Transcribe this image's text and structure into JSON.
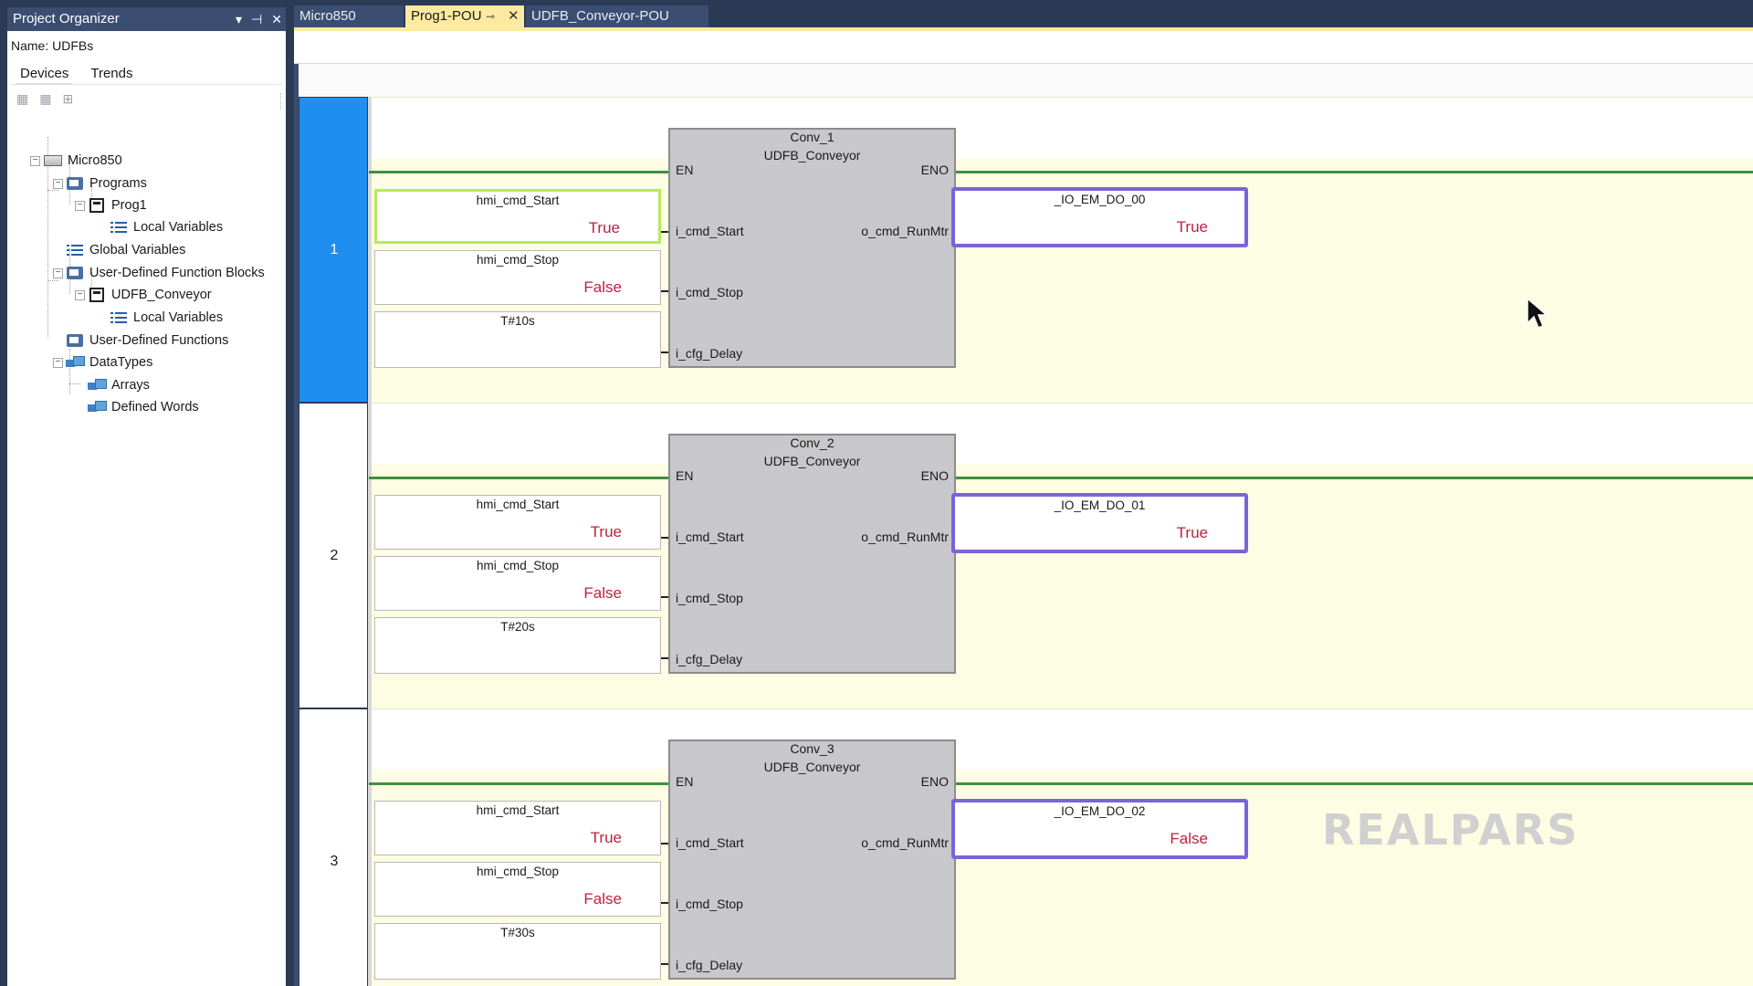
{
  "organizer": {
    "title": "Project Organizer",
    "controls": [
      "▾",
      "⊣",
      "✕"
    ],
    "name_label": "Name:",
    "name_value": "UDFBs",
    "tabs": [
      "Devices",
      "Trends"
    ],
    "tree": [
      {
        "label": "Micro850",
        "icon": "controller-icon"
      },
      {
        "label": "Programs",
        "icon": "programs-folder-icon"
      },
      {
        "label": "Prog1",
        "icon": "program-icon"
      },
      {
        "label": "Local Variables",
        "icon": "variables-list-icon"
      },
      {
        "label": "Global Variables",
        "icon": "variables-list-icon"
      },
      {
        "label": "User-Defined Function Blocks",
        "icon": "function-blocks-folder-icon"
      },
      {
        "label": "UDFB_Conveyor",
        "icon": "function-block-icon"
      },
      {
        "label": "Local Variables",
        "icon": "variables-list-icon"
      },
      {
        "label": "User-Defined Functions",
        "icon": "functions-folder-icon"
      },
      {
        "label": "DataTypes",
        "icon": "datatypes-icon"
      },
      {
        "label": "Arrays",
        "icon": "datatype-arrays-icon"
      },
      {
        "label": "Defined Words",
        "icon": "datatype-words-icon"
      }
    ]
  },
  "tabs": [
    {
      "label": "Micro850",
      "active": false
    },
    {
      "label": "Prog1-POU",
      "active": true
    },
    {
      "label": "UDFB_Conveyor-POU",
      "active": false
    }
  ],
  "rungs": [
    {
      "number": "1",
      "instance": "Conv_1",
      "fb_type": "UDFB_Conveyor",
      "pins": {
        "en": "EN",
        "eno": "ENO",
        "in1": "i_cmd_Start",
        "in2": "i_cmd_Stop",
        "in3": "i_cfg_Delay",
        "out1": "o_cmd_RunMtr"
      },
      "inputs": [
        {
          "name": "hmi_cmd_Start",
          "value": "True"
        },
        {
          "name": "hmi_cmd_Stop",
          "value": "False"
        },
        {
          "name": "T#10s",
          "value": ""
        }
      ],
      "output": {
        "name": "_IO_EM_DO_00",
        "value": "True"
      }
    },
    {
      "number": "2",
      "instance": "Conv_2",
      "fb_type": "UDFB_Conveyor",
      "pins": {
        "en": "EN",
        "eno": "ENO",
        "in1": "i_cmd_Start",
        "in2": "i_cmd_Stop",
        "in3": "i_cfg_Delay",
        "out1": "o_cmd_RunMtr"
      },
      "inputs": [
        {
          "name": "hmi_cmd_Start",
          "value": "True"
        },
        {
          "name": "hmi_cmd_Stop",
          "value": "False"
        },
        {
          "name": "T#20s",
          "value": ""
        }
      ],
      "output": {
        "name": "_IO_EM_DO_01",
        "value": "True"
      }
    },
    {
      "number": "3",
      "instance": "Conv_3",
      "fb_type": "UDFB_Conveyor",
      "pins": {
        "en": "EN",
        "eno": "ENO",
        "in1": "i_cmd_Start",
        "in2": "i_cmd_Stop",
        "in3": "i_cfg_Delay",
        "out1": "o_cmd_RunMtr"
      },
      "inputs": [
        {
          "name": "hmi_cmd_Start",
          "value": "True"
        },
        {
          "name": "hmi_cmd_Stop",
          "value": "False"
        },
        {
          "name": "T#30s",
          "value": ""
        }
      ],
      "output": {
        "name": "_IO_EM_DO_02",
        "value": "False"
      }
    }
  ],
  "watermark": "REALPARS",
  "colors": {
    "selected_rung": "#1e8ff0",
    "rung_background": "#fdfde4",
    "wire": "#3f8f3f",
    "output_highlight": "#7a64d8",
    "input_highlight": "#b8e860",
    "value_text": "#c02040",
    "function_block": "#c8c8cc",
    "active_tab": "#fbeaa0"
  }
}
